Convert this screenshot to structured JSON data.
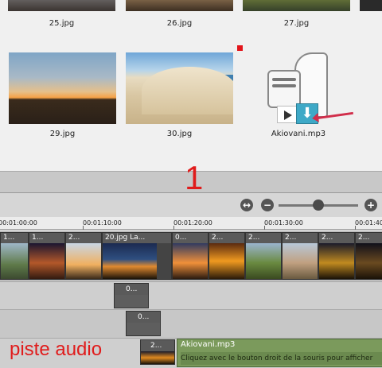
{
  "media_browser": {
    "items": [
      {
        "name": "25.jpg"
      },
      {
        "name": "26.jpg"
      },
      {
        "name": "27.jpg"
      },
      {
        "name": "29.jpg"
      },
      {
        "name": "30.jpg"
      },
      {
        "name": "Akiovani.mp3"
      }
    ]
  },
  "annotation": {
    "number": "1",
    "audio_track_label": "piste audio",
    "accent_color": "#e01c1c"
  },
  "toolbar": {
    "fit_icon": "fit-timeline-icon",
    "zoom_out_icon": "zoom-out-icon",
    "zoom_in_icon": "zoom-in-icon"
  },
  "ruler": {
    "labels": [
      "00:01:00:00",
      "00:01:10:00",
      "00:01:20:00",
      "00:01:30:00",
      "00:01:40"
    ]
  },
  "timeline": {
    "video_clips": [
      "1...",
      "1...",
      "2...",
      "20.jpg  La...",
      "0...",
      "2...",
      "2...",
      "2...",
      "2...",
      "2..."
    ],
    "overlay_clips": [
      "0...",
      "0...",
      "2..."
    ],
    "audio_clip": {
      "name": "Akiovani.mp3",
      "hint": "Cliquez avec le bouton droit de la souris pour afficher"
    }
  }
}
